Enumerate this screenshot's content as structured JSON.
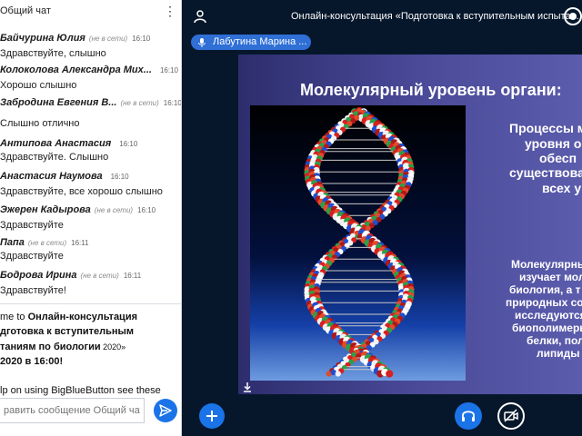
{
  "chat": {
    "title": "Общий чат",
    "menu_icon": "kebab-menu-icon",
    "messages": [
      {
        "name": "Байчурина Юлия",
        "status": "(не в сети)",
        "time": "16:10",
        "text": "Здравствуйте, слышно"
      },
      {
        "name": "Колоколова Александра Мих...",
        "status": "",
        "time": "16:10",
        "text": "Хорошо слышно"
      },
      {
        "name": "Забродина Евгения В...",
        "status": "(не в сети)",
        "time": "16:10",
        "text": "Слышно отлично"
      },
      {
        "name": "Антипова Анастасия",
        "status": "",
        "time": "16:10",
        "text": "Здравствуйте. Слышно"
      },
      {
        "name": "Анастасия Наумова",
        "status": "",
        "time": "16:10",
        "text": "Здравствуйте, все хорошо слышно"
      },
      {
        "name": "Эжерен Кадырова",
        "status": "(не в сети)",
        "time": "16:10",
        "text": "Здравствуйте"
      },
      {
        "name": "Папа",
        "status": "(не в сети)",
        "time": "16:11",
        "text": "Здравствуйте"
      },
      {
        "name": "Бодрова Ирина",
        "status": "(не в сети)",
        "time": "16:11",
        "text": "Здравствуйте!"
      }
    ],
    "welcome": {
      "line1_prefix": "me to ",
      "line1_bold": "Онлайн-консультация",
      "line2": "дготовка к вступительным",
      "line3_bold": "таниям по биологии",
      "line3_small": " 2020»",
      "line4": "2020 в 16:00!",
      "help": "lp on using BigBlueButton see these"
    },
    "input_placeholder": "равить сообщение Общий чат",
    "send_icon": "send-arrow-icon"
  },
  "topbar": {
    "user_icon": "user-icon",
    "title": "Онлайн-консультация «Подготовка к вступительным испытан...",
    "record_icon": "record-icon"
  },
  "talker": {
    "mic_icon": "microphone-icon",
    "name": "Лабутина Марина ..."
  },
  "slide": {
    "title": "Молекулярный уровень органи:",
    "text1_lines": [
      "Процессы м",
      "уровня о",
      "обесп",
      "существова",
      "всех у"
    ],
    "text2_lines": [
      "Молекулярны",
      "изучает мол",
      "биология, а т",
      "природных сое",
      "исследуются",
      "биополимеры",
      "белки, поли",
      "липиды"
    ],
    "download_icon": "download-icon"
  },
  "controls": {
    "add_icon": "plus-icon",
    "audio_icon": "headphones-icon",
    "video_icon": "video-off-icon"
  },
  "colors": {
    "accent": "#1b73e8",
    "background": "#06172b",
    "slide_bg": "#3b3b86"
  }
}
